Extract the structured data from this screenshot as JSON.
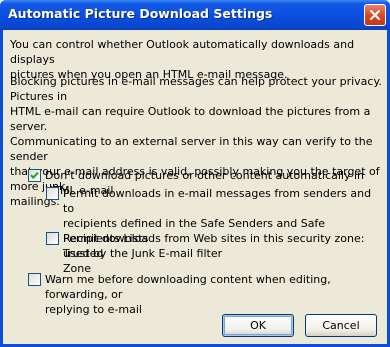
{
  "window": {
    "title": "Automatic Picture Download Settings"
  },
  "intro": {
    "lines": [
      "You can control whether Outlook automatically downloads and displays",
      "pictures when you open an HTML e-mail message."
    ]
  },
  "privacy": {
    "lines": [
      "Blocking pictures in e-mail messages can help protect your privacy. Pictures in",
      "HTML e-mail can require Outlook to download the pictures from a server.",
      "Communicating to an external server in this way can verify to the sender",
      "that your e-mail address is valid, possibly making you the target of more junk",
      "mailings."
    ]
  },
  "options": {
    "dont_download": {
      "checked": true,
      "lines": [
        "Don't download pictures or other content automatically in HTML e-mail"
      ]
    },
    "safe_senders": {
      "checked": false,
      "lines": [
        "Permit downloads in e-mail messages from senders and to",
        "recipients defined in the Safe Senders and Safe Recipients Lists",
        "used by the Junk E-mail filter"
      ]
    },
    "trusted_zone": {
      "checked": false,
      "lines": [
        "Permit downloads from Web sites in this security zone: Trusted",
        "Zone"
      ]
    },
    "warn_before": {
      "checked": false,
      "lines": [
        "Warn me before downloading content when editing, forwarding, or",
        "replying to e-mail"
      ]
    }
  },
  "buttons": {
    "ok": "OK",
    "cancel": "Cancel"
  },
  "colors": {
    "titlebar": "#0a4ee0",
    "dialog_bg": "#ece9d8",
    "checkmark": "#21a121",
    "close_button": "#d7461f"
  },
  "icons": [
    "close-icon",
    "checkmark-icon"
  ]
}
